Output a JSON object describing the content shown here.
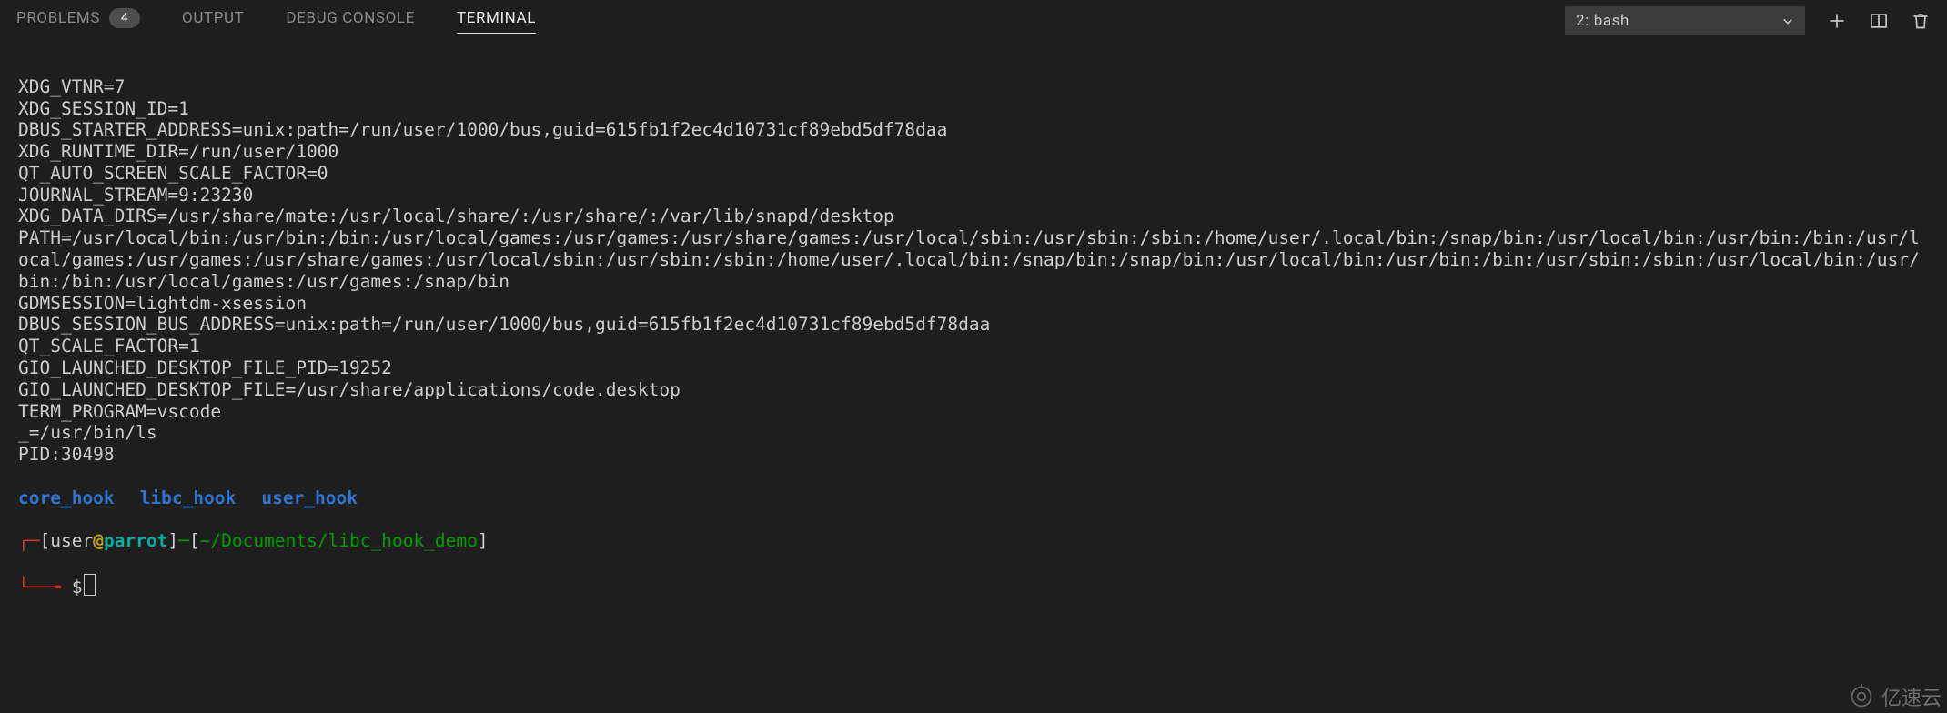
{
  "tabs": {
    "problems": {
      "label": "PROBLEMS",
      "badge": "4"
    },
    "output": {
      "label": "OUTPUT"
    },
    "debug": {
      "label": "DEBUG CONSOLE"
    },
    "terminal": {
      "label": "TERMINAL"
    }
  },
  "terminal_select": {
    "selected": "2: bash"
  },
  "env_lines": [
    "XDG_VTNR=7",
    "XDG_SESSION_ID=1",
    "DBUS_STARTER_ADDRESS=unix:path=/run/user/1000/bus,guid=615fb1f2ec4d10731cf89ebd5df78daa",
    "XDG_RUNTIME_DIR=/run/user/1000",
    "QT_AUTO_SCREEN_SCALE_FACTOR=0",
    "JOURNAL_STREAM=9:23230",
    "XDG_DATA_DIRS=/usr/share/mate:/usr/local/share/:/usr/share/:/var/lib/snapd/desktop",
    "PATH=/usr/local/bin:/usr/bin:/bin:/usr/local/games:/usr/games:/usr/share/games:/usr/local/sbin:/usr/sbin:/sbin:/home/user/.local/bin:/snap/bin:/usr/local/bin:/usr/bin:/bin:/usr/local/games:/usr/games:/usr/share/games:/usr/local/sbin:/usr/sbin:/sbin:/home/user/.local/bin:/snap/bin:/snap/bin:/usr/local/bin:/usr/bin:/bin:/usr/sbin:/sbin:/usr/local/bin:/usr/bin:/bin:/usr/local/games:/usr/games:/snap/bin",
    "GDMSESSION=lightdm-xsession",
    "DBUS_SESSION_BUS_ADDRESS=unix:path=/run/user/1000/bus,guid=615fb1f2ec4d10731cf89ebd5df78daa",
    "QT_SCALE_FACTOR=1",
    "GIO_LAUNCHED_DESKTOP_FILE_PID=19252",
    "GIO_LAUNCHED_DESKTOP_FILE=/usr/share/applications/code.desktop",
    "TERM_PROGRAM=vscode",
    "_=/usr/bin/ls",
    "PID:30498"
  ],
  "dir_list": [
    "core_hook",
    "libc_hook",
    "user_hook"
  ],
  "prompt": {
    "open_corner": "┌─",
    "lbr": "[",
    "user": "user",
    "at": "@",
    "host": "parrot",
    "rbr": "]",
    "dash": "─",
    "lbr2": "[",
    "path": "~/Documents/libc_hook_demo",
    "rbr2": "]",
    "line2_corner": "└──╼ ",
    "dollar": "$"
  },
  "watermark": {
    "text": "亿速云"
  }
}
